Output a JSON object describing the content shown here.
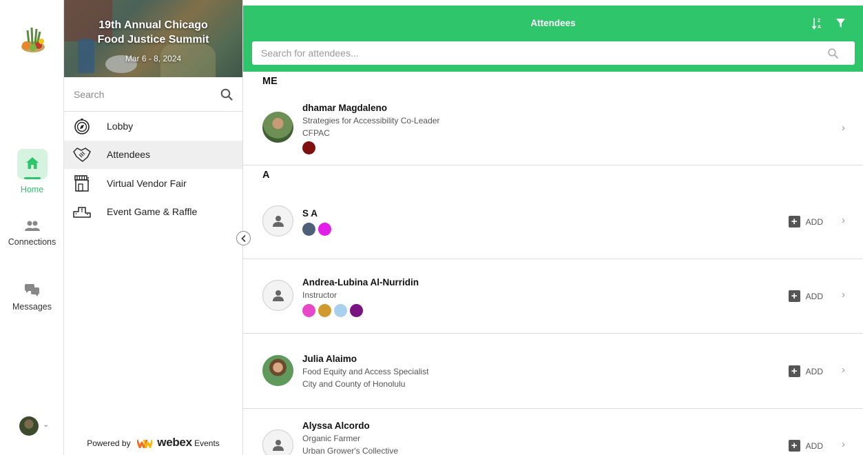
{
  "rail": {
    "home_label": "Home",
    "connections_label": "Connections",
    "messages_label": "Messages"
  },
  "event": {
    "title": "19th Annual Chicago Food Justice Summit",
    "dates": "Mar 6 - 8, 2024"
  },
  "nav": {
    "search_placeholder": "Search",
    "items": [
      {
        "label": "Lobby",
        "icon": "compass-icon"
      },
      {
        "label": "Attendees",
        "icon": "handshake-icon"
      },
      {
        "label": "Virtual Vendor Fair",
        "icon": "storefront-icon"
      },
      {
        "label": "Event Game & Raffle",
        "icon": "podium-icon"
      }
    ],
    "active_index": 1,
    "powered_by": "Powered by",
    "brand": "webex",
    "brand_suffix": "Events"
  },
  "main": {
    "title": "Attendees",
    "search_placeholder": "Search for attendees...",
    "add_label": "ADD",
    "sections": [
      {
        "letter": "ME"
      },
      {
        "letter": "A"
      }
    ],
    "attendees": [
      {
        "name": "dhamar Magdaleno",
        "title": "Strategies for Accessibility Co-Leader",
        "org": "CFPAC",
        "tags": [
          "#7f1010"
        ],
        "has_photo": true,
        "can_add": false
      },
      {
        "name": "S A",
        "title": "",
        "org": "",
        "tags": [
          "#4d6078",
          "#e21fe8"
        ],
        "has_photo": false,
        "can_add": true
      },
      {
        "name": "Andrea-Lubina Al-Nurridin",
        "title": "Instructor",
        "org": "",
        "tags": [
          "#e847c8",
          "#d09a2f",
          "#a9cfee",
          "#7a1382"
        ],
        "has_photo": false,
        "can_add": true
      },
      {
        "name": "Julia Alaimo",
        "title": "Food Equity and Access Specialist",
        "org": "City and County of Honolulu",
        "tags": [],
        "has_photo": true,
        "can_add": true
      },
      {
        "name": "Alyssa Alcordo",
        "title": "Organic Farmer",
        "org": "Urban Grower's Collective",
        "tags": [],
        "has_photo": false,
        "can_add": true
      }
    ]
  },
  "colors": {
    "accent": "#2ec56b",
    "home_tile": "#d6f3e0"
  }
}
